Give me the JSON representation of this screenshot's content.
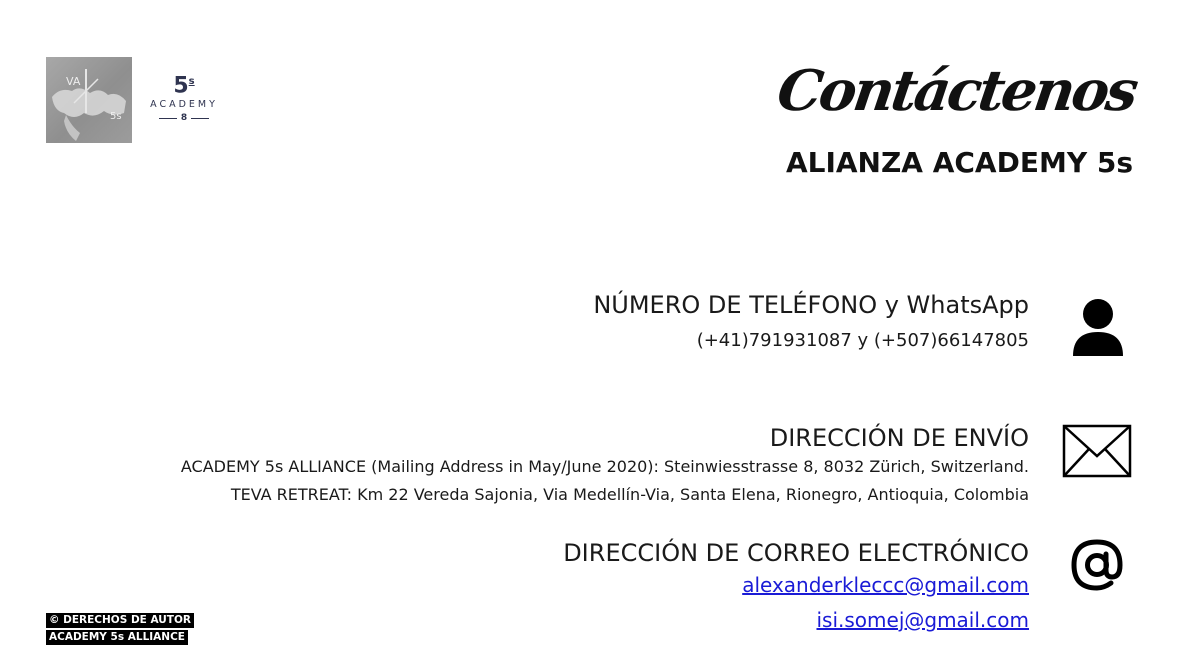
{
  "logo": {
    "five": "5",
    "five_sup": "s",
    "academy": "ACADEMY",
    "rule_glyph": "8"
  },
  "header": {
    "title": "Contáctenos",
    "subtitle": "ALIANZA ACADEMY 5s"
  },
  "phone": {
    "heading": "NÚMERO DE TELÉFONO y WhatsApp",
    "numbers": "(+41)791931087 y (+507)66147805",
    "icon": "person-icon"
  },
  "address": {
    "heading": "DIRECCIÓN DE ENVÍO",
    "line1": "ACADEMY 5s ALLIANCE (Mailing Address in May/June 2020): Steinwiesstrasse 8, 8032 Zürich, Switzerland.",
    "line2": "TEVA RETREAT: Km 22 Vereda Sajonia, Via Medellín-Via, Santa Elena, Rionegro, Antioquia, Colombia",
    "icon": "envelope-icon"
  },
  "email": {
    "heading": "DIRECCIÓN DE CORREO ELECTRÓNICO",
    "address1": "alexanderkleccc@gmail.com",
    "address2": "isi.somej@gmail.com",
    "link_color": "#1a1bd6",
    "icon": "at-sign-icon"
  },
  "copyright": {
    "line1": "© DERECHOS DE AUTOR",
    "line2": "ACADEMY  5s ALLIANCE"
  }
}
